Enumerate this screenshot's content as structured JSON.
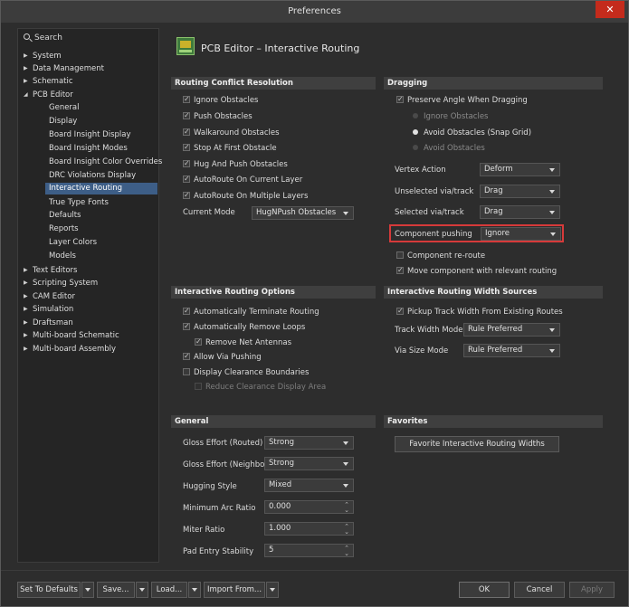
{
  "window": {
    "title": "Preferences",
    "close_label": "✕"
  },
  "search": {
    "placeholder": "Search"
  },
  "tree": {
    "items": [
      {
        "label": "System",
        "expander": "▶"
      },
      {
        "label": "Data Management",
        "expander": "▶"
      },
      {
        "label": "Schematic",
        "expander": "▶"
      },
      {
        "label": "PCB Editor",
        "expander": "◢"
      },
      {
        "label": "General"
      },
      {
        "label": "Display"
      },
      {
        "label": "Board Insight Display"
      },
      {
        "label": "Board Insight Modes"
      },
      {
        "label": "Board Insight Color Overrides"
      },
      {
        "label": "DRC Violations Display"
      },
      {
        "label": "Interactive Routing"
      },
      {
        "label": "True Type Fonts"
      },
      {
        "label": "Defaults"
      },
      {
        "label": "Reports"
      },
      {
        "label": "Layer Colors"
      },
      {
        "label": "Models"
      },
      {
        "label": "Text Editors",
        "expander": "▶"
      },
      {
        "label": "Scripting System",
        "expander": "▶"
      },
      {
        "label": "CAM Editor",
        "expander": "▶"
      },
      {
        "label": "Simulation",
        "expander": "▶"
      },
      {
        "label": "Draftsman",
        "expander": "▶"
      },
      {
        "label": "Multi-board Schematic",
        "expander": "▶"
      },
      {
        "label": "Multi-board Assembly",
        "expander": "▶"
      }
    ]
  },
  "page": {
    "title": "PCB Editor – Interactive Routing"
  },
  "conflict": {
    "header": "Routing Conflict Resolution",
    "options": [
      {
        "label": "Ignore Obstacles"
      },
      {
        "label": "Push Obstacles"
      },
      {
        "label": "Walkaround Obstacles"
      },
      {
        "label": "Stop At First Obstacle"
      },
      {
        "label": "Hug And Push Obstacles"
      },
      {
        "label": "AutoRoute On Current Layer"
      },
      {
        "label": "AutoRoute On Multiple Layers"
      }
    ],
    "mode_label": "Current Mode",
    "mode_value": "HugNPush Obstacles"
  },
  "dragging": {
    "header": "Dragging",
    "preserve_label": "Preserve Angle When Dragging",
    "radios": [
      {
        "label": "Ignore Obstacles"
      },
      {
        "label": "Avoid Obstacles (Snap Grid)"
      },
      {
        "label": "Avoid Obstacles"
      }
    ],
    "vertex_label": "Vertex Action",
    "vertex_value": "Deform",
    "unselected_label": "Unselected via/track",
    "unselected_value": "Drag",
    "selected_label": "Selected via/track",
    "selected_value": "Drag",
    "component_label": "Component pushing",
    "component_value": "Ignore",
    "reroute_label": "Component re-route",
    "move_label": "Move component with relevant routing"
  },
  "routing_options": {
    "header": "Interactive Routing Options",
    "items": [
      {
        "label": "Automatically Terminate Routing"
      },
      {
        "label": "Automatically Remove Loops"
      },
      {
        "label": "Remove Net Antennas"
      },
      {
        "label": "Allow Via Pushing"
      },
      {
        "label": "Display Clearance Boundaries"
      },
      {
        "label": "Reduce Clearance Display Area"
      }
    ]
  },
  "width_sources": {
    "header": "Interactive Routing Width Sources",
    "pickup_label": "Pickup Track Width From Existing Routes",
    "track_label": "Track Width Mode",
    "track_value": "Rule Preferred",
    "via_label": "Via Size Mode",
    "via_value": "Rule Preferred"
  },
  "general": {
    "header": "General",
    "gloss_routed_label": "Gloss Effort (Routed)",
    "gloss_routed_value": "Strong",
    "gloss_neighbor_label": "Gloss Effort (Neighbor)",
    "gloss_neighbor_value": "Strong",
    "hugging_label": "Hugging Style",
    "hugging_value": "Mixed",
    "arc_label": "Minimum Arc Ratio",
    "arc_value": "0.000",
    "miter_label": "Miter Ratio",
    "miter_value": "1.000",
    "pad_label": "Pad Entry Stability",
    "pad_value": "5"
  },
  "favorites": {
    "header": "Favorites",
    "button_label": "Favorite Interactive Routing Widths"
  },
  "footer": {
    "defaults_label": "Set To Defaults",
    "save_label": "Save...",
    "load_label": "Load...",
    "import_label": "Import From...",
    "ok_label": "OK",
    "cancel_label": "Cancel",
    "apply_label": "Apply"
  }
}
